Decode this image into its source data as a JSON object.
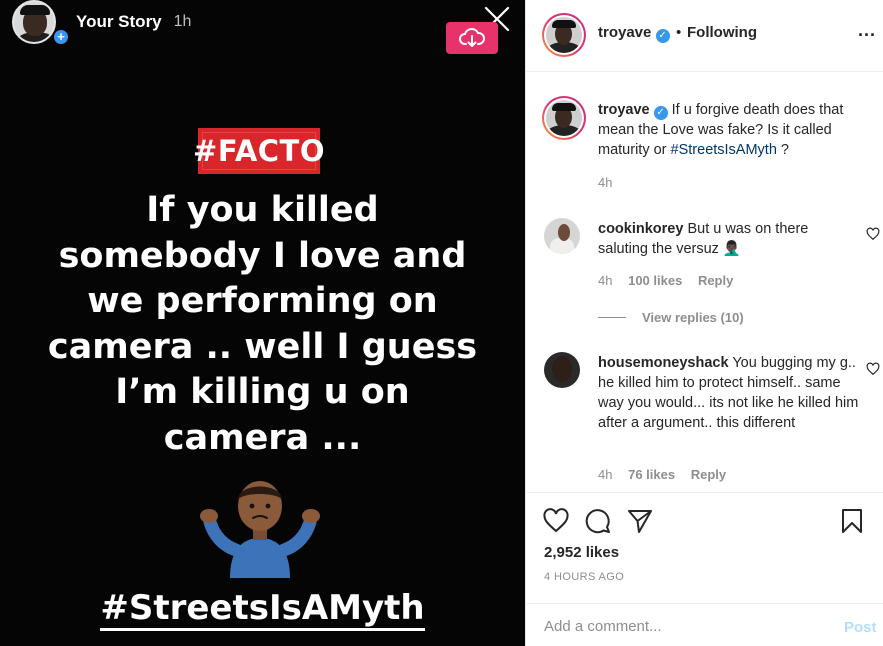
{
  "story": {
    "username": "Your Story",
    "time": "1h",
    "badge": "#FACTO",
    "lines": [
      "If you killed",
      "somebody I love and",
      "we performing on",
      "camera .. well I guess",
      "I’m killing u on",
      "camera ..."
    ],
    "emoji": "🤷🏾‍♂️",
    "hashtag": "#StreetsIsAMyth",
    "colors": {
      "badge": "#d9262b",
      "download": "#e8336a"
    }
  },
  "post": {
    "header": {
      "username": "troyave",
      "dot": "•",
      "following": "Following",
      "more": "..."
    },
    "caption": {
      "username": "troyave",
      "text": "If u forgive death does that mean the Love was fake? Is it called maturity or",
      "tag": "#StreetsIsAMyth",
      "suffix": " ?",
      "time": "4h"
    },
    "comments": [
      {
        "username": "cookinkorey",
        "text": "But u was on there saluting the versuz 🤦🏿‍♂️",
        "time": "4h",
        "likes": "100 likes",
        "reply": "Reply"
      },
      {
        "username": "housemoneyshack",
        "text": "You bugging my g.. he killed him to protect himself.. same way you would... its not like he killed him after a argument.. this different",
        "time": "4h",
        "likes": "76 likes",
        "reply": "Reply"
      }
    ],
    "view_replies": "View replies (10)",
    "likes": "2,952 likes",
    "timestamp": "4 HOURS AGO",
    "comment_placeholder": "Add a comment...",
    "post_label": "Post",
    "colors": {
      "link": "#00376b",
      "verified": "#3897f0",
      "post_disabled": "#b2dffc"
    }
  }
}
